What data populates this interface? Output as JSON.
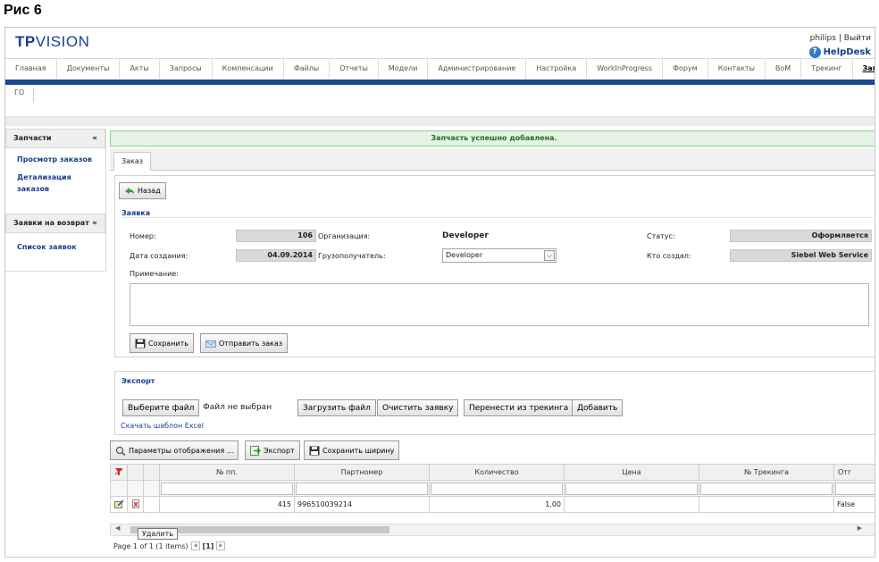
{
  "caption": "Рис 6",
  "header": {
    "logo_bold": "TP",
    "logo_rest": "VISION",
    "user": "philips",
    "sep": "|",
    "logout": "Выйти",
    "helpdesk": "HelpDesk"
  },
  "nav": [
    "Главная",
    "Документы",
    "Акты",
    "Запросы",
    "Компенсации",
    "Файлы",
    "Отчеты",
    "Модели",
    "Администрирование",
    "Настройка",
    "WorkInProgress",
    "Форум",
    "Контакты",
    "BoM",
    "Трекинг",
    "Запчасти"
  ],
  "subnav": "ГО",
  "sidebar": {
    "section1": "Запчасти",
    "links1": [
      "Просмотр заказов",
      "Детализация",
      "заказов"
    ],
    "section2": "Заявки на возврат",
    "links2": [
      "Список заявок"
    ]
  },
  "success_message": "Запчасть успешно добавлена.",
  "tab": "Заказ",
  "back_button": "Назад",
  "order": {
    "legend": "Заявка",
    "number_label": "Номер:",
    "number_value": "106",
    "org_label": "Организация:",
    "org_value": "Developer",
    "status_label": "Статус:",
    "status_value": "Оформляется",
    "date_label": "Дата создания:",
    "date_value": "04.09.2014",
    "consignee_label": "Грузополучатель:",
    "consignee_value": "Developer",
    "creator_label": "Кто создал:",
    "creator_value": "Siebel Web Service",
    "note_label": "Примечание:",
    "save_button": "Сохранить",
    "send_button": "Отправить заказ"
  },
  "export": {
    "title": "Экспорт",
    "choose_file": "Выберите файл",
    "no_file": "Файл не выбран",
    "upload": "Загрузить файл",
    "clear": "Очистить заявку",
    "transfer": "Перенести из трекинга",
    "add": "Добавить",
    "excel_link": "Скачать шаблон Excel"
  },
  "toolbar": {
    "display_params": "Параметры отображения ...",
    "export": "Экспорт",
    "save_width": "Сохранить ширину"
  },
  "table": {
    "columns": [
      "№ пп.",
      "Партномер",
      "Количество",
      "Цена",
      "№ Трекинга",
      "Отг"
    ],
    "rows": [
      {
        "num": "415",
        "part": "996510039214",
        "qty": "1,00",
        "price": "",
        "tracking": "",
        "shipped": "False"
      }
    ]
  },
  "tooltip": "Удалить",
  "pager": {
    "text": "Page 1 of 1 (1 items)",
    "current": "[1]"
  }
}
